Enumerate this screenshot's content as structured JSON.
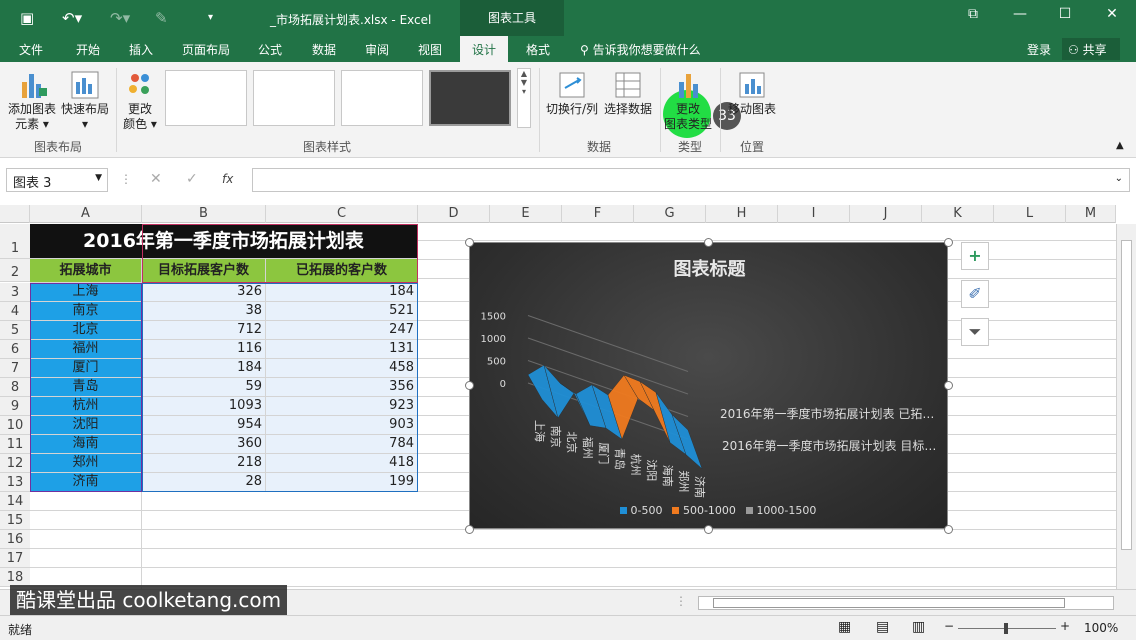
{
  "window": {
    "title": "_市场拓展计划表.xlsx - Excel",
    "context_tab": "图表工具"
  },
  "tabs": [
    "文件",
    "开始",
    "插入",
    "页面布局",
    "公式",
    "数据",
    "审阅",
    "视图",
    "设计",
    "格式"
  ],
  "active_tab": "设计",
  "tell_me": "告诉我你想要做什么",
  "login": "登录",
  "share": "共享",
  "ribbon": {
    "add_element": [
      "添加图表",
      "元素 ▾"
    ],
    "quick_layout": [
      "快速布局",
      "▾"
    ],
    "change_color": [
      "更改",
      "颜色 ▾"
    ],
    "group_layout": "图表布局",
    "group_styles": "图表样式",
    "switch_row_col": "切换行/列",
    "select_data": "选择数据",
    "group_data": "数据",
    "change_type": [
      "更改",
      "图表类型"
    ],
    "group_type": "类型",
    "move_chart": "移动图表",
    "group_position": "位置",
    "badge": "33"
  },
  "namebox": "图表 3",
  "fx_label": "fx",
  "columns": [
    "A",
    "B",
    "C",
    "D",
    "E",
    "F",
    "G",
    "H",
    "I",
    "J",
    "K",
    "L",
    "M"
  ],
  "rows": [
    "1",
    "2",
    "3",
    "4",
    "5",
    "6",
    "7",
    "8",
    "9",
    "10",
    "11",
    "12",
    "13",
    "14",
    "15",
    "16",
    "17",
    "18"
  ],
  "sheet": {
    "title": "2016年第一季度市场拓展计划表",
    "headers": [
      "拓展城市",
      "目标拓展客户数",
      "已拓展的客户数"
    ],
    "data": [
      [
        "上海",
        "326",
        "184"
      ],
      [
        "南京",
        "38",
        "521"
      ],
      [
        "北京",
        "712",
        "247"
      ],
      [
        "福州",
        "116",
        "131"
      ],
      [
        "厦门",
        "184",
        "458"
      ],
      [
        "青岛",
        "59",
        "356"
      ],
      [
        "杭州",
        "1093",
        "923"
      ],
      [
        "沈阳",
        "954",
        "903"
      ],
      [
        "海南",
        "360",
        "784"
      ],
      [
        "郑州",
        "218",
        "418"
      ],
      [
        "济南",
        "28",
        "199"
      ]
    ]
  },
  "chart_data": {
    "type": "area",
    "title": "图表标题",
    "categories": [
      "上海",
      "南京",
      "北京",
      "福州",
      "厦门",
      "青岛",
      "杭州",
      "沈阳",
      "海南",
      "郑州",
      "济南"
    ],
    "series": [
      {
        "name": "2016年第一季度市场拓展计划表 目标…",
        "values": [
          326,
          38,
          712,
          116,
          184,
          59,
          1093,
          954,
          360,
          218,
          28
        ]
      },
      {
        "name": "2016年第一季度市场拓展计划表 已拓…",
        "values": [
          184,
          521,
          247,
          131,
          458,
          356,
          923,
          903,
          784,
          418,
          199
        ]
      }
    ],
    "yticks": [
      "1500",
      "1000",
      "500",
      "0"
    ],
    "legend": [
      "0-500",
      "500-1000",
      "1000-1500"
    ],
    "legend_colors": [
      "#1f8fd6",
      "#f07a1f",
      "#9a9a9a"
    ],
    "legend_position": "bottom"
  },
  "status": {
    "ready": "就绪",
    "zoom": "100%"
  },
  "watermark": "酷课堂出品 coolketang.com",
  "colors": {
    "excel_green": "#217346",
    "header_green": "#8cc63f",
    "city_blue": "#1ea0e6",
    "title_black": "#111111"
  }
}
